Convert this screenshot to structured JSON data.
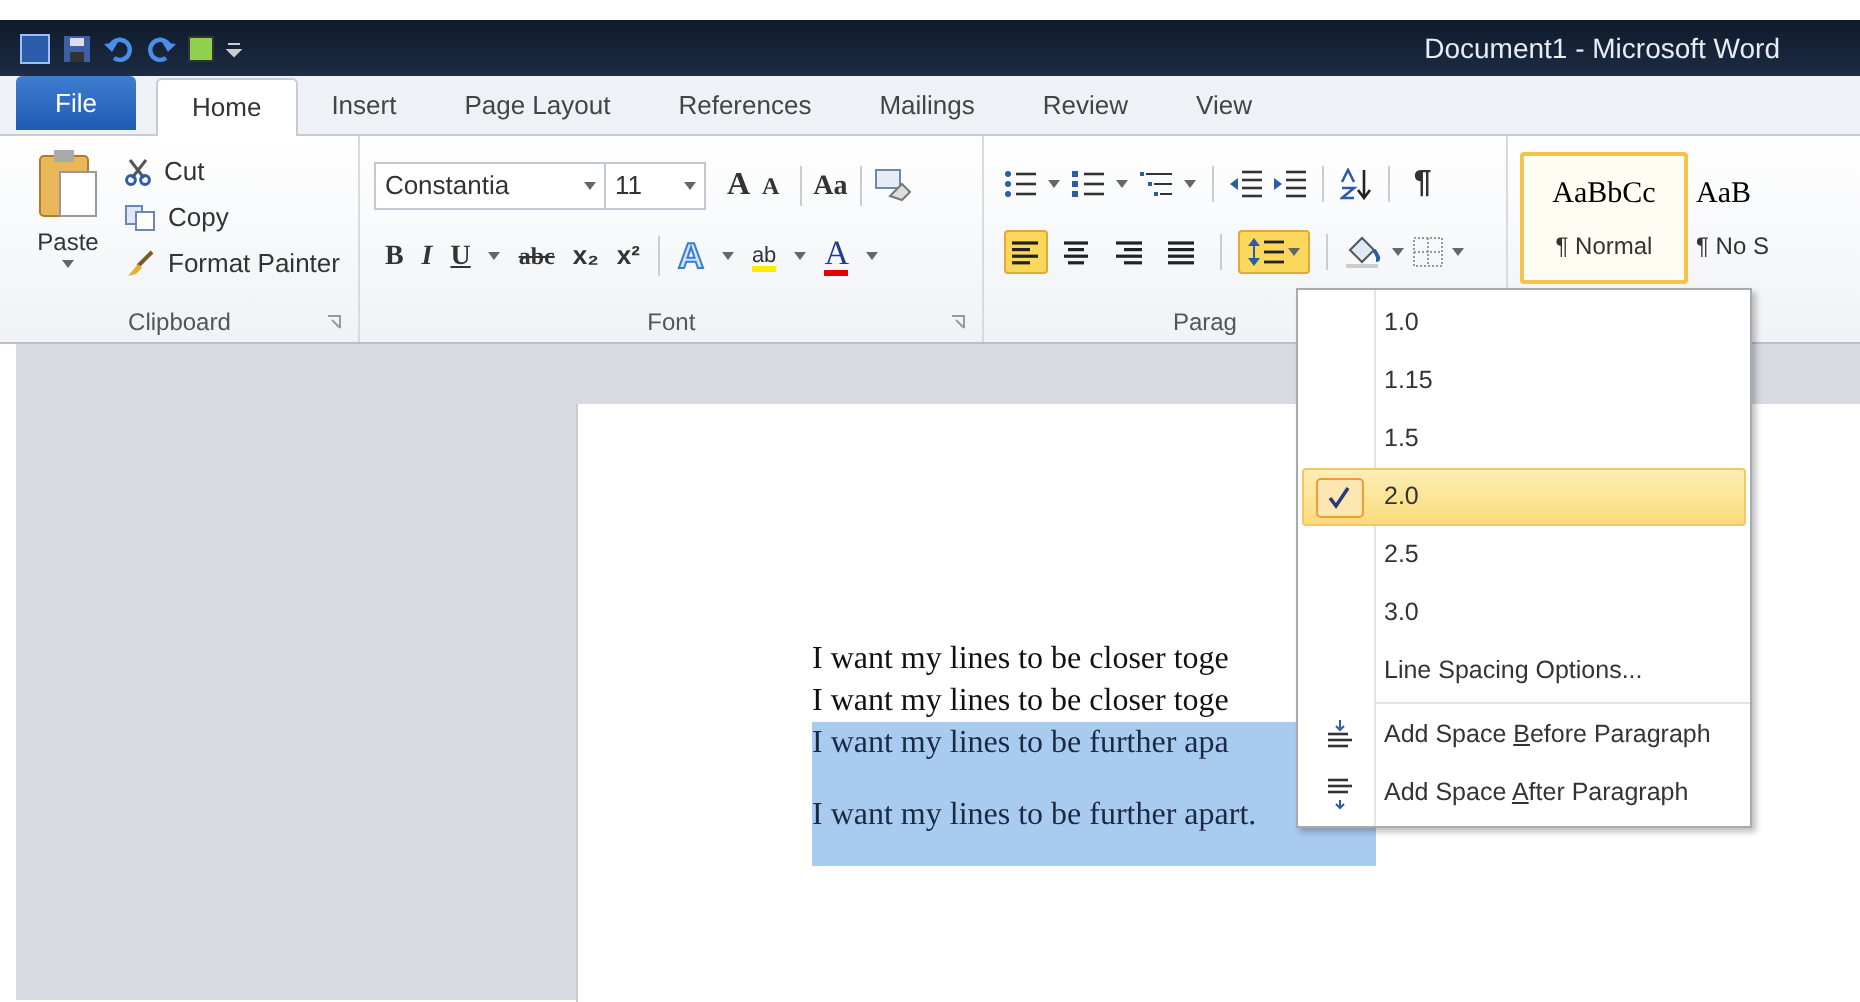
{
  "window": {
    "title": "Document1 - Microsoft Word"
  },
  "tabs": [
    {
      "label": "File",
      "kind": "file",
      "selected": false
    },
    {
      "label": "Home",
      "kind": "tab",
      "selected": true
    },
    {
      "label": "Insert",
      "kind": "tab",
      "selected": false
    },
    {
      "label": "Page Layout",
      "kind": "tab",
      "selected": false
    },
    {
      "label": "References",
      "kind": "tab",
      "selected": false
    },
    {
      "label": "Mailings",
      "kind": "tab",
      "selected": false
    },
    {
      "label": "Review",
      "kind": "tab",
      "selected": false
    },
    {
      "label": "View",
      "kind": "tab",
      "selected": false
    }
  ],
  "clipboard": {
    "paste": "Paste",
    "cut": "Cut",
    "copy": "Copy",
    "painter": "Format Painter",
    "label": "Clipboard"
  },
  "font": {
    "name": "Constantia",
    "size": "11",
    "grow": "A",
    "shrink": "A",
    "case": "Aa",
    "bold": "B",
    "italic": "I",
    "underline": "U",
    "strike": "abc",
    "sub": "x₂",
    "sup": "x²",
    "effects": "A",
    "highlight": "ab",
    "color_glyph": "A",
    "label": "Font"
  },
  "paragraph": {
    "pilcrow": "¶",
    "label": "Parag",
    "alignments": [
      {
        "selected": true
      },
      {
        "selected": false
      },
      {
        "selected": false
      },
      {
        "selected": false
      }
    ],
    "line_spacing_open": true
  },
  "styles": [
    {
      "sample": "AaBbCc",
      "name": "¶ Normal",
      "selected": true
    },
    {
      "sample": "AaB",
      "name": "¶ No S",
      "selected": false
    }
  ],
  "document": {
    "lines": [
      {
        "text": "I want my lines to be closer toge",
        "selected": false
      },
      {
        "text": "I want my lines to be closer toge",
        "selected": false
      },
      {
        "text": "I want my lines to be further apa",
        "selected": true
      },
      {
        "text": "I want my lines to be further apart.",
        "selected": true
      }
    ]
  },
  "menu": {
    "items": [
      {
        "kind": "option",
        "label": "1.0",
        "checked": false
      },
      {
        "kind": "option",
        "label": "1.15",
        "checked": false
      },
      {
        "kind": "option",
        "label": "1.5",
        "checked": false
      },
      {
        "kind": "option",
        "label": "2.0",
        "checked": true
      },
      {
        "kind": "option",
        "label": "2.5",
        "checked": false
      },
      {
        "kind": "option",
        "label": "3.0",
        "checked": false
      },
      {
        "kind": "command",
        "label": "Line Spacing Options..."
      },
      {
        "kind": "before",
        "parts": [
          "Add Space ",
          "B",
          "efore Paragraph"
        ]
      },
      {
        "kind": "after",
        "parts": [
          "Add Space ",
          "A",
          "fter Paragraph"
        ]
      }
    ]
  }
}
